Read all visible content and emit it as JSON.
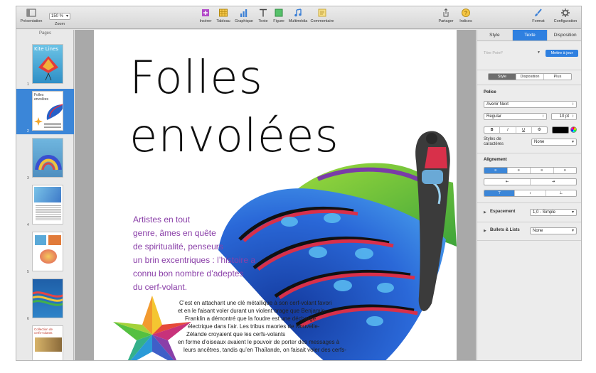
{
  "toolbar": {
    "view_label": "Présentation",
    "zoom_value": "150 %",
    "zoom_label": "Zoom",
    "insert_label": "Insérer",
    "table_label": "Tableau",
    "chart_label": "Graphique",
    "text_label": "Texte",
    "shape_label": "Figure",
    "media_label": "Multimédia",
    "comment_label": "Commentaire",
    "share_label": "Partager",
    "tips_label": "Indices",
    "format_label": "Format",
    "setup_label": "Configuration"
  },
  "pages_panel": {
    "title": "Pages",
    "thumbnails": [
      {
        "num": "1",
        "caption": "Kite Lines"
      },
      {
        "num": "2",
        "caption": "Folles envolées"
      },
      {
        "num": "3",
        "caption": ""
      },
      {
        "num": "4",
        "caption": ""
      },
      {
        "num": "5",
        "caption": ""
      },
      {
        "num": "6",
        "caption": ""
      },
      {
        "num": "",
        "caption": "Collection de cerfs-volants"
      }
    ]
  },
  "document": {
    "title_line1": "Folles",
    "title_line2": "envolées",
    "lead_lines": [
      "Artistes en tout",
      "genre, âmes en quête",
      "de spiritualité, penseurs",
      "un brin excentriques : l’histoire a",
      "connu bon nombre d’adeptes",
      "du cerf-volant."
    ],
    "body_lines": [
      "C’est en attachant une clé métallique à son cerf-volant favori",
      "et en le faisant voler durant un violent orage que Benjamin",
      "Franklin a démontré que la foudre est une décharge",
      "électrique dans l’air. Les tribus maories de Nouvelle-",
      "Zélande croyaient que les cerfs-volants",
      "en forme d’oiseaux avaient le pouvoir de porter des messages à",
      "leurs ancêtres, tandis qu’en Thaïlande, on faisait voler des cerfs-"
    ]
  },
  "inspector": {
    "tabs": [
      "Style",
      "Texte",
      "Disposition"
    ],
    "active_tab": "Texte",
    "para_style": "Titre Point*",
    "update_button": "Mettre à jour",
    "subtabs": [
      "Style",
      "Disposition",
      "Plus"
    ],
    "font_heading": "Police",
    "font_family": "Avenir Next",
    "font_weight": "Regular",
    "font_size": "10 pt",
    "bold": "B",
    "italic": "I",
    "underline": "U",
    "more_glyph": "⚙",
    "char_styles_label": "Styles de caractères",
    "char_styles_value": "None",
    "alignment_heading": "Alignement",
    "spacing_label": "Espacement",
    "spacing_value": "1,0 - Simple",
    "bullets_label": "Bullets & Lists",
    "bullets_value": "None",
    "text_color": "#000000",
    "accent": "#2f80e0"
  }
}
